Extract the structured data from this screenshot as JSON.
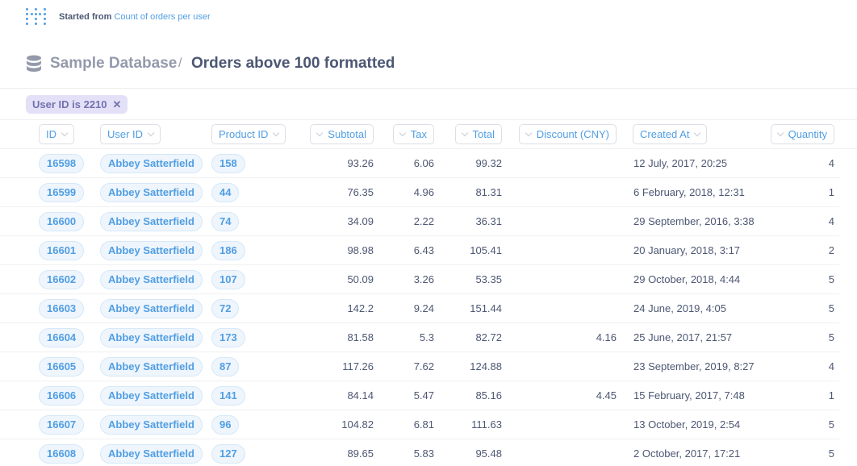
{
  "header": {
    "started_label": "Started from",
    "started_link": "Count of orders per user",
    "logo_icon": "metabase-logo-icon"
  },
  "breadcrumb": {
    "database": "Sample Database",
    "separator": "/",
    "title": "Orders above 100 formatted",
    "icon": "database-icon"
  },
  "filter": {
    "label": "User ID is 2210",
    "remove_icon": "close-icon"
  },
  "table": {
    "columns": [
      "ID",
      "User ID",
      "Product ID",
      "Subtotal",
      "Tax",
      "Total",
      "Discount (CNY)",
      "Created At",
      "Quantity"
    ],
    "rows": [
      [
        "16598",
        "Abbey Satterfield",
        "158",
        "93.26",
        "6.06",
        "99.32",
        "",
        "12 July, 2017, 20:25",
        "4"
      ],
      [
        "16599",
        "Abbey Satterfield",
        "44",
        "76.35",
        "4.96",
        "81.31",
        "",
        "6 February, 2018, 12:31",
        "1"
      ],
      [
        "16600",
        "Abbey Satterfield",
        "74",
        "34.09",
        "2.22",
        "36.31",
        "",
        "29 September, 2016, 3:38",
        "4"
      ],
      [
        "16601",
        "Abbey Satterfield",
        "186",
        "98.98",
        "6.43",
        "105.41",
        "",
        "20 January, 2018, 3:17",
        "2"
      ],
      [
        "16602",
        "Abbey Satterfield",
        "107",
        "50.09",
        "3.26",
        "53.35",
        "",
        "29 October, 2018, 4:44",
        "5"
      ],
      [
        "16603",
        "Abbey Satterfield",
        "72",
        "142.2",
        "9.24",
        "151.44",
        "",
        "24 June, 2019, 4:05",
        "5"
      ],
      [
        "16604",
        "Abbey Satterfield",
        "173",
        "81.58",
        "5.3",
        "82.72",
        "4.16",
        "25 June, 2017, 21:57",
        "5"
      ],
      [
        "16605",
        "Abbey Satterfield",
        "87",
        "117.26",
        "7.62",
        "124.88",
        "",
        "23 September, 2019, 8:27",
        "4"
      ],
      [
        "16606",
        "Abbey Satterfield",
        "141",
        "84.14",
        "5.47",
        "85.16",
        "4.45",
        "15 February, 2017, 7:48",
        "1"
      ],
      [
        "16607",
        "Abbey Satterfield",
        "96",
        "104.82",
        "6.81",
        "111.63",
        "",
        "13 October, 2019, 2:54",
        "5"
      ],
      [
        "16608",
        "Abbey Satterfield",
        "127",
        "89.65",
        "5.83",
        "95.48",
        "",
        "2 October, 2017, 17:21",
        "5"
      ]
    ]
  },
  "colors": {
    "brand": "#509ee3",
    "text": "#4c5773",
    "muted": "#949aab",
    "filter_bg": "#e4e0f7",
    "filter_text": "#7172ad"
  }
}
